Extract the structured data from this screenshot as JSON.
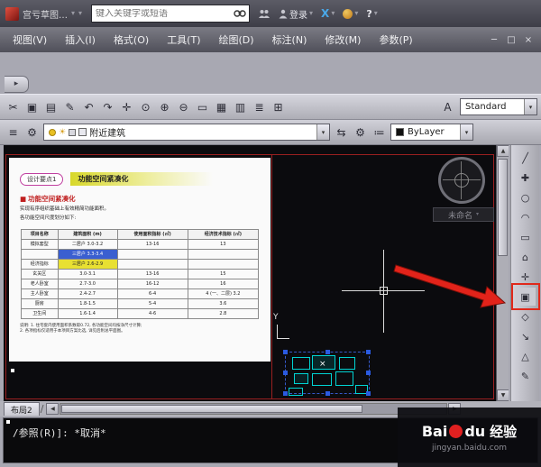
{
  "glyphs": {
    "caret": "▾",
    "minimize": "─",
    "maximize": "□",
    "close": "×",
    "scroll_left": "◀",
    "scroll_right": "▶",
    "scroll_up": "▲",
    "scroll_down": "▼",
    "tab_slash": "∕",
    "collapse_arrow": "▸",
    "bullet": "■",
    "x_logo": "X",
    "help": "?"
  },
  "titlebar": {
    "workspace": "宫亏草图…",
    "search_placeholder": "键入关键字或短语",
    "login": "登录"
  },
  "menubar": {
    "items": [
      "视图(V)",
      "插入(I)",
      "格式(O)",
      "工具(T)",
      "绘图(D)",
      "标注(N)",
      "修改(M)",
      "参数(P)"
    ]
  },
  "toolbar_row1": {
    "icons": [
      "✂",
      "▣",
      "▤",
      "✎",
      "↶",
      "↷",
      "✛",
      "⊙",
      "⊕",
      "⊖",
      "▭",
      "▦",
      "▥",
      "≣",
      "⊞"
    ],
    "text_icon": "A",
    "style_value": "Standard"
  },
  "toolbar_row2": {
    "left_icons": [
      "≡",
      "⚙"
    ],
    "sun": "☀",
    "layer_value": "附近建筑",
    "mid_icons": [
      "⇆",
      "⚙",
      "≔"
    ],
    "color_value": "ByLayer"
  },
  "canvas": {
    "view_name": "未命名",
    "axis_label": "Y",
    "plan_close_mark": "×",
    "document": {
      "badge": "设计要点1",
      "title": "功能空间紧凑化",
      "heading": "功能空间紧凑化",
      "para1": "实现有序组织基础上有效精简功能面积。",
      "para2": "各功能空间尺度划分如下:",
      "table": {
        "headers": [
          "项目名称",
          "建筑面积 (m)",
          "使用面积指标 (㎡)",
          "经济技术指标 (㎡)"
        ],
        "rows": [
          {
            "cells": [
              "模拟套型",
              "二居户 3.0-3.2",
              "13-16",
              "13"
            ]
          },
          {
            "cells": [
              "",
              "三居户 3.3-3.4",
              "",
              ""
            ],
            "hl": {
              "1": "blue"
            }
          },
          {
            "cells": [
              "经济指标",
              "三居户 2.6-2.9",
              "",
              ""
            ],
            "hl": {
              "1": "yellow"
            }
          },
          {
            "cells": [
              "玄关区",
              "3.0-3.1",
              "13-16",
              "15"
            ]
          },
          {
            "cells": [
              "老人卧室",
              "2.7-3.0",
              "16-12",
              "16"
            ]
          },
          {
            "cells": [
              "主人卧室",
              "2.4-2.7",
              "6-4",
              "4 (一、二层) 3.2"
            ]
          },
          {
            "cells": [
              "厨房",
              "1.8-1.5",
              "5-4",
              "3.6"
            ]
          },
          {
            "cells": [
              "卫生间",
              "1.6-1.4",
              "4-6",
              "2.8"
            ]
          }
        ]
      },
      "notes": [
        "说明: 1. 住宅套内使用面积系数取0.72, 各功能空间均按净尺寸计算;",
        "2. 各项指标仅适用于本项目方案比选, 详见后附总平面图。"
      ]
    }
  },
  "right_toolbar": {
    "icons": [
      "╱",
      "✚",
      "○",
      "◠",
      "▭",
      "⌂",
      "✛",
      "▣",
      "◇",
      "↘",
      "△",
      "✎"
    ],
    "highlight_index": 7
  },
  "layout": {
    "tab": "布局2"
  },
  "command": {
    "line1": "/参照(R)]: *取消*"
  },
  "watermark": {
    "bai": "Bai",
    "du": "du",
    "badge": "经验",
    "url": "jingyan.baidu.com"
  }
}
